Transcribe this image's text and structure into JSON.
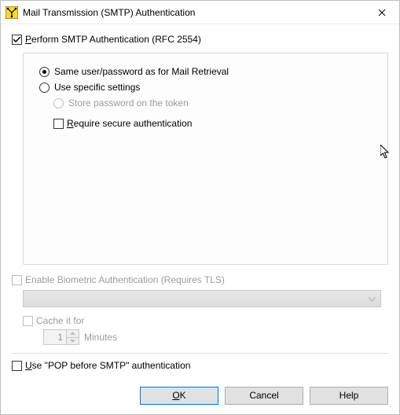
{
  "window": {
    "title": "Mail Transmission (SMTP) Authentication"
  },
  "perform": {
    "prefix": "P",
    "rest": "erform SMTP Authentication (RFC 2554)"
  },
  "radio": {
    "same": "Same user/password as for Mail Retrieval",
    "specific": "Use specific settings",
    "store": "Store password on the token"
  },
  "require": {
    "prefix": "R",
    "rest": "equire secure authentication"
  },
  "biometric": {
    "label": "Enable Biometric Authentication (Requires TLS)"
  },
  "cache": {
    "label": "Cache it for",
    "value": "1",
    "unit": "Minutes"
  },
  "pop": {
    "prefix": "U",
    "rest": "se \"POP before SMTP\" authentication"
  },
  "buttons": {
    "ok_u": "O",
    "ok_rest": "K",
    "cancel": "Cancel",
    "help": "Help"
  }
}
